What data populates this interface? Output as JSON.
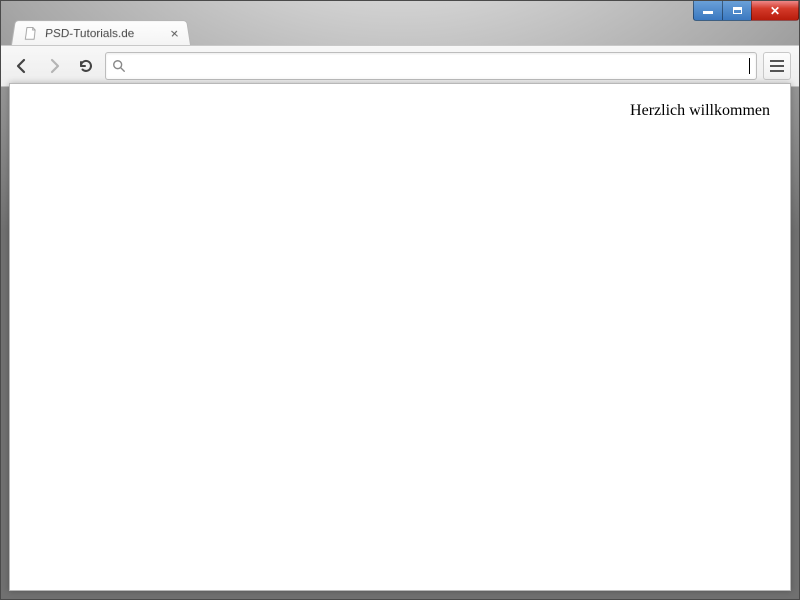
{
  "tab": {
    "title": "PSD-Tutorials.de"
  },
  "omnibox": {
    "value": "",
    "placeholder": ""
  },
  "page": {
    "heading": "Herzlich willkommen"
  }
}
